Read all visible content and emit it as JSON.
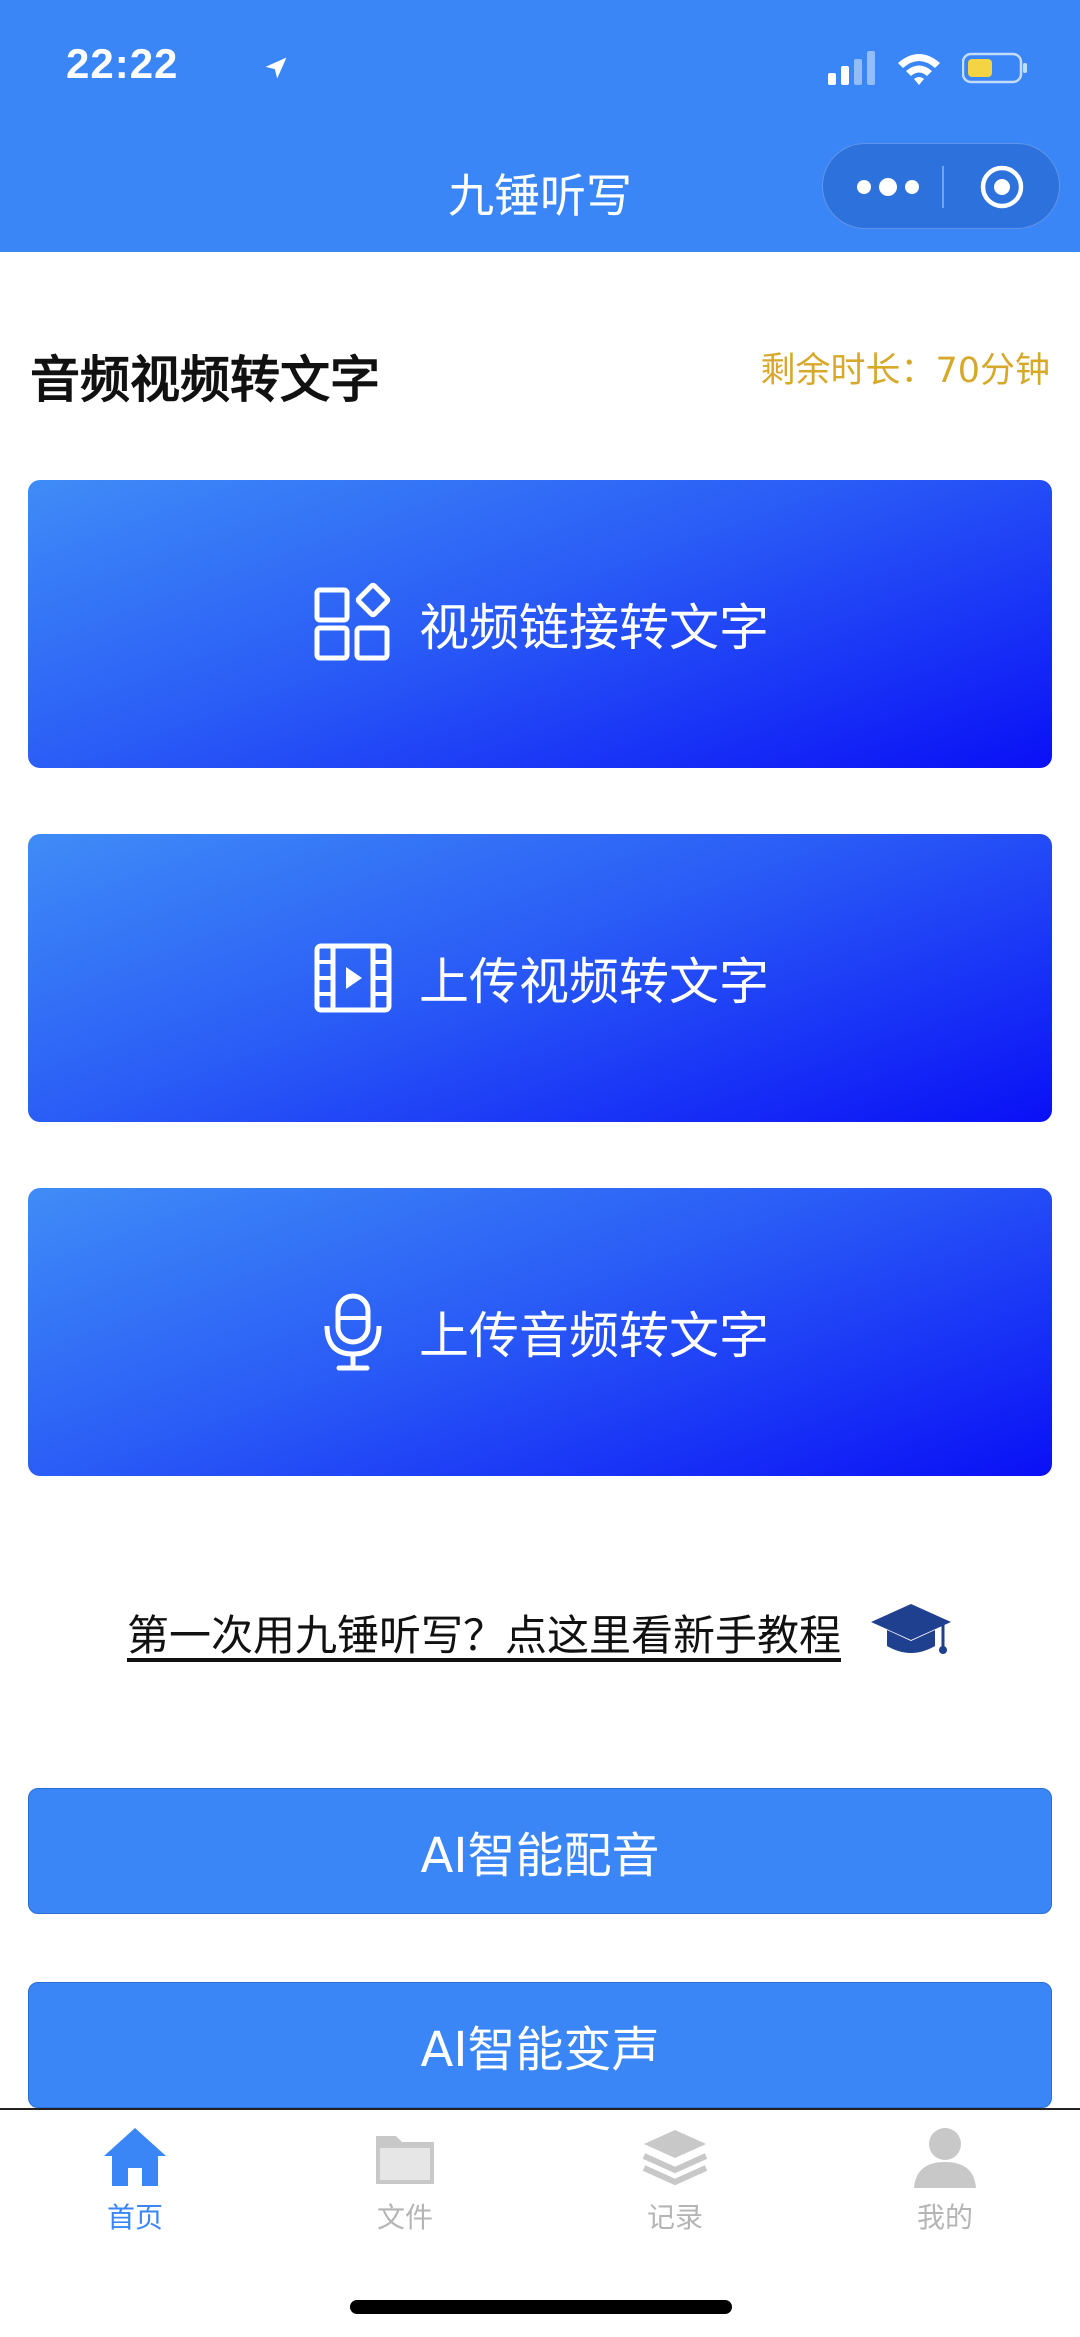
{
  "status_bar": {
    "time": "22:22"
  },
  "nav": {
    "title": "九锤听写"
  },
  "section": {
    "title": "音频视频转文字",
    "remaining": "剩余时长：70分钟"
  },
  "actions": [
    {
      "label": "视频链接转文字",
      "icon": "apps-grid-icon"
    },
    {
      "label": "上传视频转文字",
      "icon": "film-play-icon"
    },
    {
      "label": "上传音频转文字",
      "icon": "microphone-icon"
    }
  ],
  "tutorial": {
    "text": "第一次用九锤听写？点这里看新手教程",
    "icon": "graduation-cap-icon"
  },
  "extras": [
    {
      "label": "AI智能配音"
    },
    {
      "label": "AI智能变声"
    }
  ],
  "tabs": [
    {
      "label": "首页",
      "icon": "home-icon",
      "active": true
    },
    {
      "label": "文件",
      "icon": "folder-icon",
      "active": false
    },
    {
      "label": "记录",
      "icon": "layers-icon",
      "active": false
    },
    {
      "label": "我的",
      "icon": "user-icon",
      "active": false
    }
  ],
  "colors": {
    "primary": "#3a86f7",
    "gradient_end": "#0a10f6",
    "accent_gold": "#d7a92b",
    "tab_inactive": "#b5b5b5"
  }
}
